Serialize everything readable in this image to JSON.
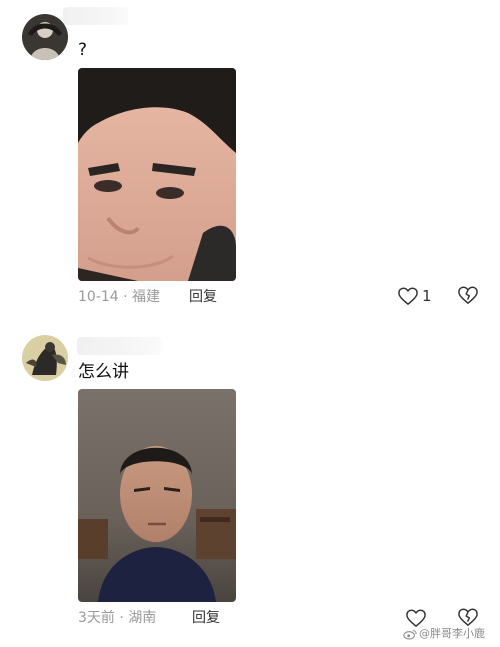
{
  "comments": [
    {
      "username": "",
      "text": "?",
      "date": "10-14",
      "location": "福建",
      "reply_label": "回复",
      "likes": "1"
    },
    {
      "username": "",
      "text": "怎么讲",
      "date": "3天前",
      "location": "湖南",
      "reply_label": "回复",
      "likes": ""
    }
  ],
  "meta_separator": "·",
  "icons": {
    "like": "heart-outline-icon",
    "dislike": "broken-heart-icon",
    "watermark": "weibo-logo-icon"
  },
  "watermark": {
    "text": "@胖哥李小鹿"
  },
  "colors": {
    "meta_text": "#9a9a9a",
    "icon_stroke": "#333333"
  }
}
